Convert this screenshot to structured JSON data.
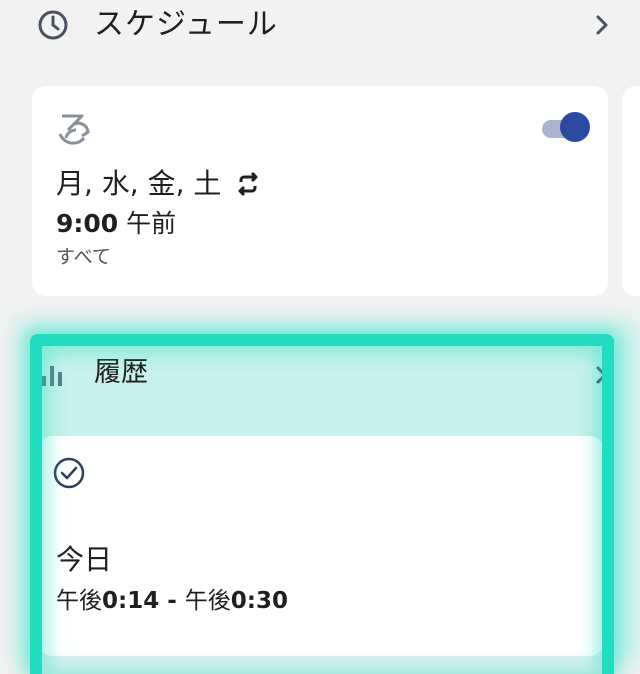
{
  "schedule": {
    "title": "スケジュール",
    "icon": "clock-icon"
  },
  "schedule_card": {
    "icon": "fan-icon",
    "toggle": {
      "state": "on",
      "color": "#2d4aa3"
    },
    "days": "月, 水, 金, 土",
    "repeat_icon": "repeat-icon",
    "time_number": "9:00",
    "time_suffix": "午前",
    "target": "すべて"
  },
  "history": {
    "title": "履歴",
    "icon": "bar-chart-icon",
    "entry": {
      "icon": "check-circle-icon",
      "day": "今日",
      "range_start_prefix": "午後",
      "range_start": "0:14",
      "separator": " - ",
      "range_end_prefix": "午後",
      "range_end": "0:30"
    }
  },
  "highlight_color": "#22dcc0"
}
